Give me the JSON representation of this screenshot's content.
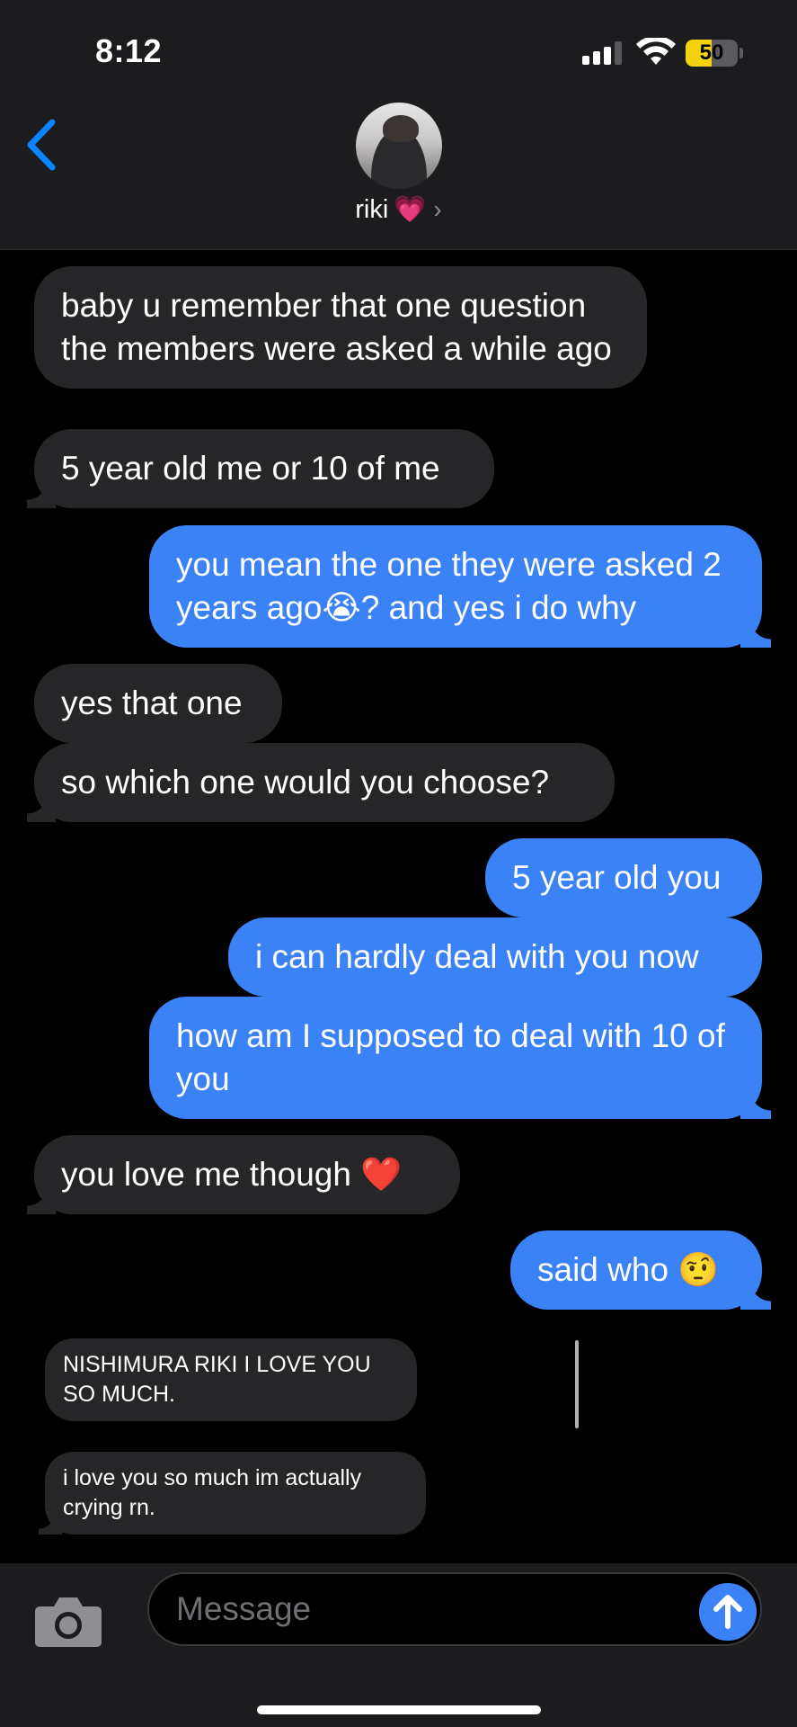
{
  "status_bar": {
    "time": "8:12",
    "battery_level": "50",
    "battery_fraction": 0.5,
    "battery_color": "#f5d10f",
    "signal_bars_active": 3,
    "signal_bars_total": 4
  },
  "header": {
    "back_icon": "chevron-left-icon",
    "contact_name": "riki",
    "contact_emoji": "💗",
    "details_chevron": "›",
    "accent_color": "#0a84ff"
  },
  "messages": [
    {
      "direction": "incoming",
      "text": "baby u remember that one question the members were asked a while ago"
    },
    {
      "direction": "incoming",
      "text": "5 year old me or 10 of me"
    },
    {
      "direction": "outgoing",
      "text": "you mean the one they were asked 2 years ago😭? and yes i do why"
    },
    {
      "direction": "incoming",
      "text": "yes that one"
    },
    {
      "direction": "incoming",
      "text": "so which one would you choose?"
    },
    {
      "direction": "outgoing",
      "text": "5 year old you"
    },
    {
      "direction": "outgoing",
      "text": "i can hardly deal with you now"
    },
    {
      "direction": "outgoing",
      "text": "how am I supposed to deal with 10 of you"
    },
    {
      "direction": "incoming",
      "text": "you love me though ❤️"
    },
    {
      "direction": "outgoing",
      "text": "said who 🤨"
    }
  ],
  "overlay_messages": [
    {
      "direction": "incoming",
      "text": "NISHIMURA RIKI I LOVE YOU SO MUCH."
    },
    {
      "direction": "incoming",
      "text": "i love you so much im actually crying rn."
    }
  ],
  "composer": {
    "placeholder": "Message",
    "camera_icon": "camera-icon",
    "send_icon": "arrow-up-icon"
  },
  "colors": {
    "outgoing_bubble": "#3b82f6",
    "incoming_bubble": "#262628",
    "background": "#000000"
  }
}
